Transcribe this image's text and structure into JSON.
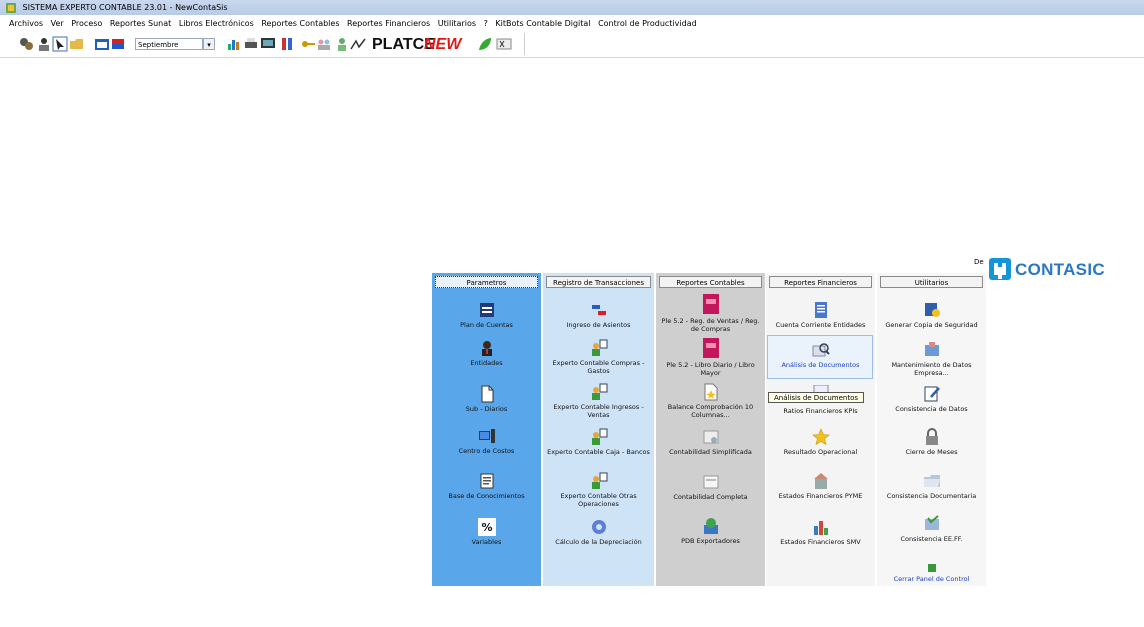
{
  "window": {
    "title": "SISTEMA EXPERTO CONTABLE 23.01 - NewContaSis"
  },
  "menu": [
    "Archivos",
    "Ver",
    "Proceso",
    "Reportes Sunat",
    "Libros Electrónicos",
    "Reportes Contables",
    "Reportes Financieros",
    "Utilitarios",
    "?",
    "KitBots Contable Digital",
    "Control de Productividad"
  ],
  "toolbar": {
    "month_value": "Septiembre",
    "platce_label": "PLATCE",
    "new_label": "NEW"
  },
  "logo": {
    "prefix": "De",
    "name": "CONTASIC"
  },
  "columns": [
    {
      "header": "Parametros",
      "items": [
        "Plan de Cuentas",
        "Entidades",
        "Sub - Diarios",
        "Centro de Costos",
        "Base de Conocimientos",
        "Variables"
      ]
    },
    {
      "header": "Registro de Transacciones",
      "items": [
        "Ingreso de Asientos",
        "Experto Contable Compras - Gastos",
        "Experto Contable Ingresos - Ventas",
        "Experto Contable Caja - Bancos",
        "Experto Contable Otras Operaciones",
        "Cálculo de la Depreciación"
      ]
    },
    {
      "header": "Reportes Contables",
      "items": [
        "Ple 5.2 - Reg. de Ventas / Reg. de Compras",
        "Ple 5.2 - Libro Diario / Libro Mayor",
        "Balance Comprobación 10 Columnas...",
        "Contabilidad Simplificada",
        "Contabilidad Completa",
        "PDB Exportadores"
      ]
    },
    {
      "header": "Reportes Financieros",
      "items": [
        "Cuenta Corriente Entidades",
        "Análisis de Documentos",
        "Ratios Financieros KPIs",
        "Resultado Operacional",
        "Estados Financieros PYME",
        "Estados Financieros SMV"
      ]
    },
    {
      "header": "Utilitarios",
      "items": [
        "Generar Copia de Seguridad",
        "Mantenimiento de Datos Empresa...",
        "Consistencia de Datos",
        "Cierre de Meses",
        "Consistencia Documentaria",
        "Consistencia EE.FF.",
        "Cerrar Panel de Control"
      ]
    }
  ],
  "tooltip": "Análisis de Documentos",
  "colors": {
    "parametros_bg": "#5aa6ea",
    "registro_bg": "#cfe3f7",
    "reportes_contables_bg": "#cfcfcf",
    "reportes_financieros_bg": "#f4f4f4",
    "utilitarios_bg": "#f6f6f6",
    "link": "#1a3cc9"
  }
}
